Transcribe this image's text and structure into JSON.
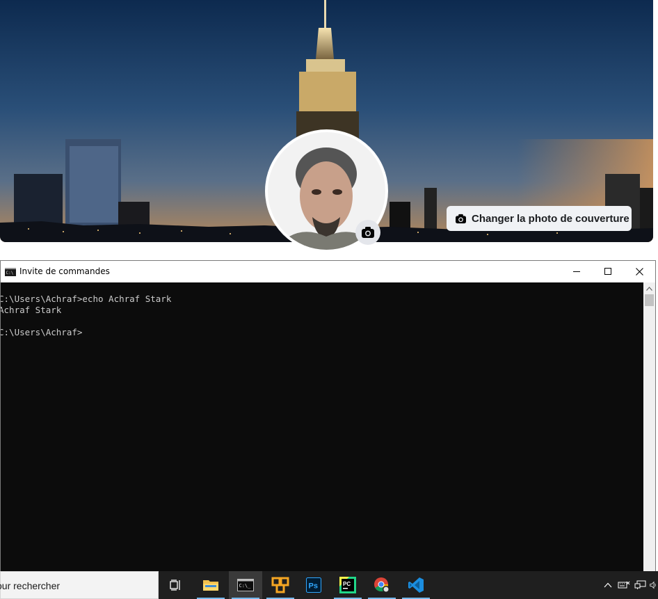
{
  "facebook": {
    "change_cover_label": "Changer la photo de couverture",
    "icons": {
      "change_cover": "camera-icon",
      "profile_photo": "camera-icon"
    }
  },
  "cmd_window": {
    "title": "Invite de commandes",
    "lines": [
      "C:\\Users\\Achraf>echo Achraf Stark",
      "Achraf Stark",
      "",
      "C:\\Users\\Achraf>"
    ],
    "buttons": {
      "minimize": "minimize-icon",
      "maximize": "maximize-icon",
      "close": "close-icon"
    },
    "colors": {
      "background": "#0c0c0c",
      "text": "#cccccc"
    }
  },
  "taskbar": {
    "search_placeholder": "our rechercher",
    "apps": [
      {
        "name": "task-view",
        "icon": "task-view-icon"
      },
      {
        "name": "file-explorer",
        "icon": "folder-icon"
      },
      {
        "name": "command-prompt",
        "icon": "terminal-icon",
        "active": true
      },
      {
        "name": "vmware",
        "icon": "vmware-icon"
      },
      {
        "name": "photoshop",
        "icon": "photoshop-icon",
        "text": "Ps"
      },
      {
        "name": "pycharm",
        "icon": "pycharm-icon",
        "text": "PC"
      },
      {
        "name": "chrome",
        "icon": "chrome-icon"
      },
      {
        "name": "vscode",
        "icon": "vscode-icon"
      }
    ],
    "tray": [
      "chevron-up-icon",
      "keyboard-icon",
      "network-icon",
      "volume-icon"
    ],
    "colors": {
      "background": "#1f1f1f",
      "accent": "#76b9ed"
    }
  }
}
